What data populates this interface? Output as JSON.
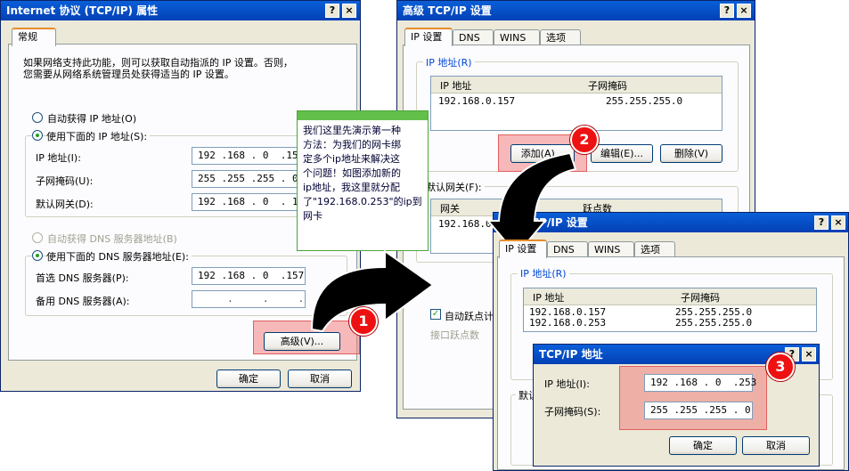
{
  "w1": {
    "title": "Internet 协议 (TCP/IP) 属性",
    "help": "?",
    "close": "×",
    "tab": "常规",
    "desc1": "如果网络支持此功能，则可以获取自动指派的 IP 设置。否则，",
    "desc2": "您需要从网络系统管理员处获得适当的 IP 设置。",
    "radio_auto_ip": "自动获得 IP 地址(O)",
    "radio_manual_ip": "使用下面的 IP 地址(S):",
    "ip_label": "IP 地址(I):",
    "ip_value": "192 .168 . 0  .157",
    "mask_label": "子网掩码(U):",
    "mask_value": "255 .255 .255 . 0",
    "gw_label": "默认网关(D):",
    "gw_value": "192 .168 . 0  . 1",
    "radio_auto_dns": "自动获得 DNS 服务器地址(B)",
    "radio_manual_dns": "使用下面的 DNS 服务器地址(E):",
    "dns1_label": "首选 DNS 服务器(P):",
    "dns1_value": "192 .168 . 0  .157",
    "dns2_label": "备用 DNS 服务器(A):",
    "dns2_value": "     .     .     .",
    "advanced": "高级(V)...",
    "ok": "确定",
    "cancel": "取消"
  },
  "w2": {
    "title": "高级 TCP/IP 设置",
    "help": "?",
    "close": "×",
    "tabs": [
      "IP 设置",
      "DNS",
      "WINS",
      "选项"
    ],
    "group_ip": "IP 地址(R)",
    "col_ip": "IP 地址",
    "col_mask": "子网掩码",
    "row1_ip": "192.168.0.157",
    "row1_mask": "255.255.255.0",
    "add": "添加(A)...",
    "edit": "编辑(E)...",
    "del": "删除(V)",
    "group_gw": "默认网关(F):",
    "col_gw": "网关",
    "col_metric": "跃点数",
    "gw_row": "192.168.0.",
    "auto_metric": "自动跃点计",
    "iface_metric": "接口跃点数"
  },
  "w3": {
    "title": "高级 TCP/IP 设置",
    "help": "?",
    "close": "×",
    "tabs": [
      "IP 设置",
      "DNS",
      "WINS",
      "选项"
    ],
    "group_ip": "IP 地址(R)",
    "col_ip": "IP 地址",
    "col_mask": "子网掩码",
    "rows": [
      {
        "ip": "192.168.0.157",
        "mask": "255.255.255.0"
      },
      {
        "ip": "192.168.0.253",
        "mask": "255.255.255.0"
      }
    ],
    "group_gw": "默认"
  },
  "w4": {
    "title": "TCP/IP 地址",
    "help": "?",
    "close": "×",
    "ip_label": "IP 地址(I):",
    "ip_value": "192 .168 . 0  .253",
    "mask_label": "子网掩码(S):",
    "mask_value": "255 .255 .255 . 0",
    "ok": "确定",
    "cancel": "取消"
  },
  "note": "我们这里先演示第一种\n方法：为我们的网卡绑\n定多个ip地址来解决这\n个问题！如图添加新的\nip地址，我这里就分配\n了\"192.168.0.253\"的ip到\n网卡",
  "badges": [
    "1",
    "2",
    "3"
  ]
}
